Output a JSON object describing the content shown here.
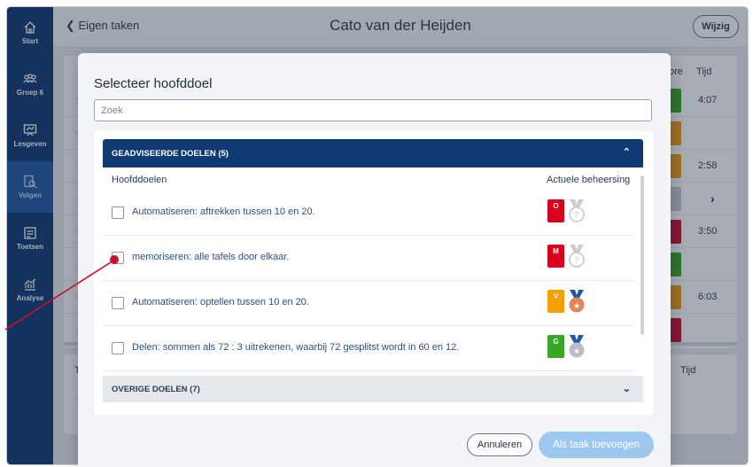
{
  "sidebar": {
    "items": [
      {
        "label": "Start",
        "icon": "home-icon"
      },
      {
        "label": "Groep 6",
        "icon": "group-icon"
      },
      {
        "label": "Lesgeven",
        "icon": "teach-icon"
      },
      {
        "label": "Volgen",
        "icon": "follow-icon",
        "active": true
      },
      {
        "label": "Toetsen",
        "icon": "test-icon"
      },
      {
        "label": "Analyse",
        "icon": "analysis-icon"
      }
    ]
  },
  "header": {
    "back_label": "Eigen taken",
    "title": "Cato van der Heijden",
    "edit_label": "Wijzig"
  },
  "background": {
    "col_score": "ore",
    "col_time": "Tijd",
    "times": [
      "4:07",
      "",
      "2:58",
      "",
      "3:50",
      "",
      "6:03",
      ""
    ],
    "block_colors": [
      "#3aa627",
      "#f09c18",
      "#f09c18",
      "#c8ced6",
      "#c8102e",
      "#3aa627",
      "#f09c18",
      "#c8102e"
    ],
    "lower_col_left": "Ta",
    "lower_col_time": "Tijd"
  },
  "modal": {
    "title": "Selecteer hoofddoel",
    "search_placeholder": "Zoek",
    "section_advised": "GEADVISEERDE DOELEN (5)",
    "col_goals": "Hoofddoelen",
    "col_mastery": "Actuele beheersing",
    "goals": [
      {
        "label": "Automatiseren: aftrekken tussen 10 en 20.",
        "badge": "O",
        "badge_color": "#d9001b",
        "medal": "grey-medal-icon"
      },
      {
        "label": "memoriseren: alle tafels door elkaar.",
        "badge": "M",
        "badge_color": "#d9001b",
        "medal": "grey-medal-icon"
      },
      {
        "label": "Automatiseren: optellen tussen 10 en 20.",
        "badge": "V",
        "badge_color": "#f5a000",
        "medal": "bronze-medal-icon"
      },
      {
        "label": "Delen: sommen als 72 : 3 uitrekenen, waarbij 72 gesplitst wordt in 60 en 12.",
        "badge": "G",
        "badge_color": "#3aa627",
        "medal": "silver-medal-icon"
      }
    ],
    "section_other": "OVERIGE DOELEN (7)",
    "cancel_label": "Annuleren",
    "add_label": "Als taak toevoegen"
  },
  "colors": {
    "navy": "#0f3a73",
    "accent_button": "#9cc7ee",
    "pointer": "#c8102e"
  }
}
